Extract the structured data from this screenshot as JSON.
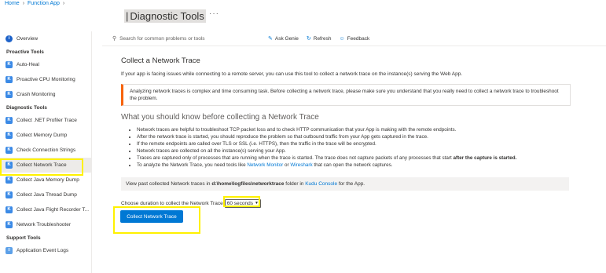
{
  "breadcrumb": {
    "home": "Home",
    "function_app": "Function App"
  },
  "title": "Diagnostic Tools",
  "title_bar": "|",
  "more": "···",
  "sidebar": {
    "overview": "Overview",
    "section1": "Proactive Tools",
    "proactive": [
      "Auto-Heal",
      "Proactive CPU Monitoring",
      "Crash Monitoring"
    ],
    "section2": "Diagnostic Tools",
    "diagnostic": [
      "Collect .NET Profiler Trace",
      "Collect Memory Dump",
      "Check Connection Strings",
      "Collect Network Trace",
      "Collect Java Memory Dump",
      "Collect Java Thread Dump",
      "Collect Java Flight Recorder T...",
      "Network Troubleshooter"
    ],
    "section3": "Support Tools",
    "support": [
      "Application Event Logs"
    ]
  },
  "toolbar": {
    "search_placeholder": "Search for common problems or tools",
    "ask_genie": "Ask Genie",
    "refresh": "Refresh",
    "feedback": "Feedback"
  },
  "main": {
    "heading": "Collect a Network Trace",
    "intro": "If your app is facing issues while connecting to a remote server, you can use this tool to collect a network trace on the instance(s) serving the Web App.",
    "warning": "Analyzing network traces is complex and time consuming task. Before collecting a network trace, please make sure you understand that you really need to collect a network trace to troubleshoot the problem.",
    "subheading": "What you should know before collecting a Network Trace",
    "b1": "Network traces are helpful to troubleshoot TCP packet loss and to check HTTP communication that your App is making with the remote endpoints.",
    "b2": "After the network trace is started, you should reproduce the problem so that outbound traffic from your App gets captured in the trace.",
    "b3": "If the remote endpoints are called over TLS or SSL (i.e. HTTPS), then the traffic in the trace will be encrypted.",
    "b4": "Network traces are collected on all the instance(s) serving your App.",
    "b5_pre": "Traces are captured only of processes that are running when the trace is started. The trace does not capture packets of any processes that start ",
    "b5_bold": "after the capture is started.",
    "b6_pre": "To analyze the Network Trace, you need tools like ",
    "b6_link1": "Network Monitor",
    "b6_mid": " or ",
    "b6_link2": "Wireshark",
    "b6_post": " that can open the network captures.",
    "info_pre": "View past collected Network traces in ",
    "info_path": "d:\\home\\logfiles\\networktrace",
    "info_mid": " folder in ",
    "info_link": "Kudu Console",
    "info_post": " for the App.",
    "choose_label": "Choose duration to collect the Network Trace",
    "duration": "60 seconds",
    "collect_button": "Collect Network Trace"
  },
  "colors": {
    "accent": "#0078d4",
    "warning": "#f7630c",
    "highlight": "#fff100"
  }
}
